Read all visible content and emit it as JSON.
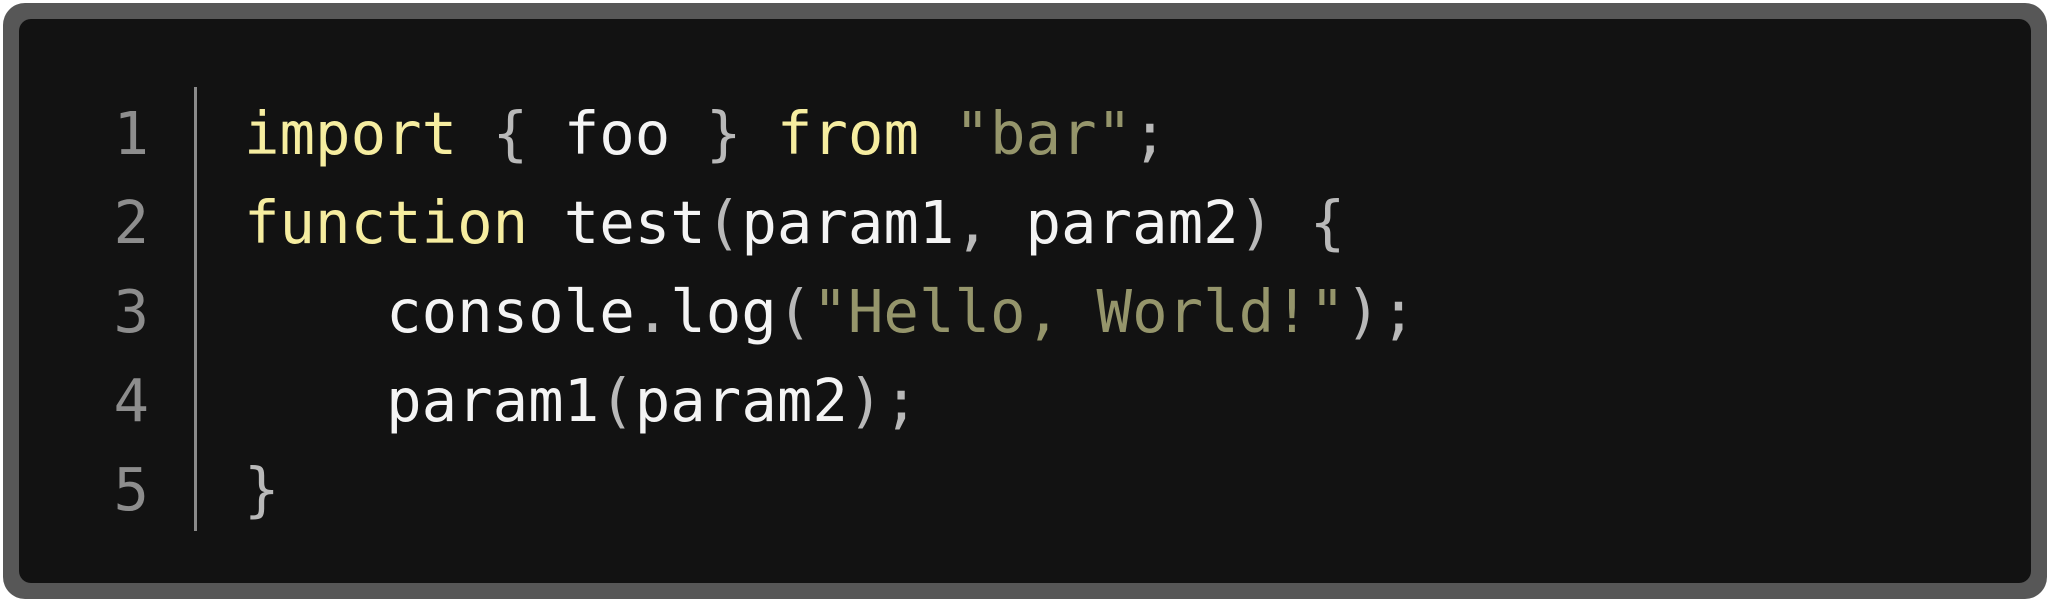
{
  "editor": {
    "line_numbers": [
      "1",
      "2",
      "3",
      "4",
      "5"
    ],
    "colors": {
      "frame": "#575757",
      "background": "#121212",
      "keyword": "#f6eda0",
      "string": "#95956b",
      "punctuation": "#b9b9b9",
      "identifier": "#f4f4f4",
      "line_number": "#8d8d8d"
    },
    "lines": [
      [
        {
          "t": "import",
          "k": "kw"
        },
        {
          "t": " ",
          "k": "id"
        },
        {
          "t": "{",
          "k": "punc"
        },
        {
          "t": " foo ",
          "k": "id"
        },
        {
          "t": "}",
          "k": "punc"
        },
        {
          "t": " ",
          "k": "id"
        },
        {
          "t": "from",
          "k": "kw"
        },
        {
          "t": " ",
          "k": "id"
        },
        {
          "t": "\"bar\"",
          "k": "str"
        },
        {
          "t": ";",
          "k": "punc"
        }
      ],
      [
        {
          "t": "function",
          "k": "kw"
        },
        {
          "t": " test",
          "k": "id"
        },
        {
          "t": "(",
          "k": "punc"
        },
        {
          "t": "param1",
          "k": "id"
        },
        {
          "t": ",",
          "k": "punc"
        },
        {
          "t": " param2",
          "k": "id"
        },
        {
          "t": ")",
          "k": "punc"
        },
        {
          "t": " ",
          "k": "id"
        },
        {
          "t": "{",
          "k": "punc"
        }
      ],
      [
        {
          "t": "    console",
          "k": "id"
        },
        {
          "t": ".",
          "k": "punc"
        },
        {
          "t": "log",
          "k": "id"
        },
        {
          "t": "(",
          "k": "punc"
        },
        {
          "t": "\"Hello, World!\"",
          "k": "str"
        },
        {
          "t": ");",
          "k": "punc"
        }
      ],
      [
        {
          "t": "    param1",
          "k": "id"
        },
        {
          "t": "(",
          "k": "punc"
        },
        {
          "t": "param2",
          "k": "id"
        },
        {
          "t": ");",
          "k": "punc"
        }
      ],
      [
        {
          "t": "}",
          "k": "punc"
        }
      ]
    ]
  }
}
